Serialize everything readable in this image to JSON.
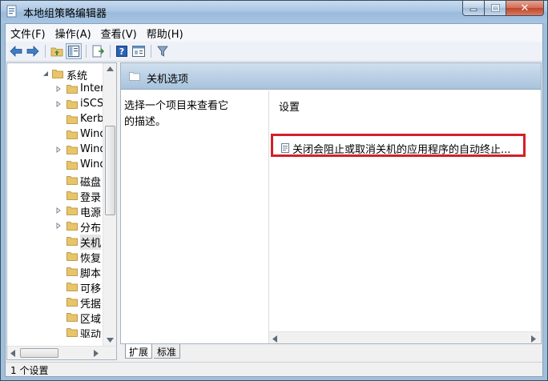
{
  "window": {
    "title": "本地组策略编辑器",
    "close_glyph": "✕"
  },
  "menu": [
    {
      "label": "文件(F)"
    },
    {
      "label": "操作(A)"
    },
    {
      "label": "查看(V)"
    },
    {
      "label": "帮助(H)"
    }
  ],
  "toolbar": {
    "buttons": [
      "back-icon",
      "forward-icon",
      "up-folder-icon",
      "show-tree-icon",
      "export-icon",
      "help-icon",
      "properties-icon",
      "filter-icon"
    ]
  },
  "tree": {
    "items": [
      {
        "label": "系统",
        "expanded": true
      },
      {
        "label": "Inter",
        "expander": true
      },
      {
        "label": "iSCSI",
        "expander": true
      },
      {
        "label": "Kerb",
        "expander": false
      },
      {
        "label": "Wind",
        "expander": false
      },
      {
        "label": "Wind",
        "expander": true
      },
      {
        "label": "Wind",
        "expander": false
      },
      {
        "label": "磁盘",
        "expander": false
      },
      {
        "label": "登录",
        "expander": false
      },
      {
        "label": "电源",
        "expander": true
      },
      {
        "label": "分布",
        "expander": true
      },
      {
        "label": "关机",
        "expander": false,
        "selected": true
      },
      {
        "label": "恢复",
        "expander": false
      },
      {
        "label": "脚本",
        "expander": false
      },
      {
        "label": "可移",
        "expander": false
      },
      {
        "label": "凭据",
        "expander": false
      },
      {
        "label": "区域",
        "expander": false
      },
      {
        "label": "驱动",
        "expander": false
      }
    ]
  },
  "details": {
    "header_title": "关机选项",
    "description": "选择一个项目来查看它的描述。",
    "column_header": "设置",
    "rows": [
      {
        "label": "关闭会阻止或取消关机的应用程序的自动终止..."
      }
    ]
  },
  "tabs": [
    {
      "label": "扩展"
    },
    {
      "label": "标准"
    }
  ],
  "status": {
    "text": "1 个设置"
  },
  "colors": {
    "highlight": "#d41f2a",
    "folder": "#e8c56a"
  }
}
